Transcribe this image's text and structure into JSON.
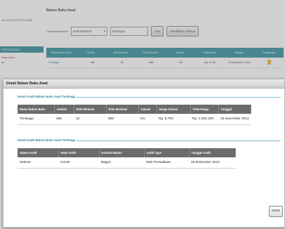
{
  "background": {
    "datetime": "ber 2012 | 00:37:05 WIB",
    "page_title": "Bahan Baku Awal",
    "menu_items": [
      "PERSEDIAAN",
      "Baku Awal",
      "an"
    ],
    "filter": {
      "label": "Cari Berdasarkan",
      "select_value": "Nama Bahan",
      "input_value": "tembaga",
      "search_button": "Cari",
      "show_all_button": "Tampilkan Semua"
    },
    "table": {
      "headers": [
        "Nama Bahan Awal",
        "Jumlah",
        "Stok Minimal",
        "Stok Maximal",
        "Satuan",
        "Harga Awal",
        "Tanggal",
        "Pengaturan"
      ],
      "rows": [
        [
          "Tembaga",
          "466",
          "33",
          "666",
          "KG",
          "Rp. 8.700",
          "20 November 2012",
          ""
        ]
      ]
    }
  },
  "dialog": {
    "title": "Detail Bahan Baku Awal",
    "section1": {
      "legend": "Detail Audit Bahan Baku Awal Tembaga",
      "headers": [
        "Nama Bahan Baku",
        "Jumlah",
        "Stok Minimal",
        "Stok Maximal",
        "Satuan",
        "Harga Satuan",
        "Total Harga",
        "Tanggal"
      ],
      "row": [
        "Tembaga",
        "466",
        "33",
        "666",
        "KG",
        "Rp. 8.700",
        "Rp. 4.054.200",
        "20 November 2012"
      ]
    },
    "section2": {
      "legend": "Detail Audit Bahan Baku Awal Tembaga",
      "headers": [
        "Status Audit",
        "Hasil Audit",
        "Kondisi Bahan",
        "Audit Type",
        "Tanggal Audit"
      ],
      "row": [
        "Selesai",
        "Cocok",
        "Bagus",
        "Stok Persediaan",
        "26 Desember 2012"
      ]
    },
    "close_button": "Close"
  },
  "colors": {
    "accent": "#2f8f9d",
    "table_header": "#6b6b6b"
  }
}
